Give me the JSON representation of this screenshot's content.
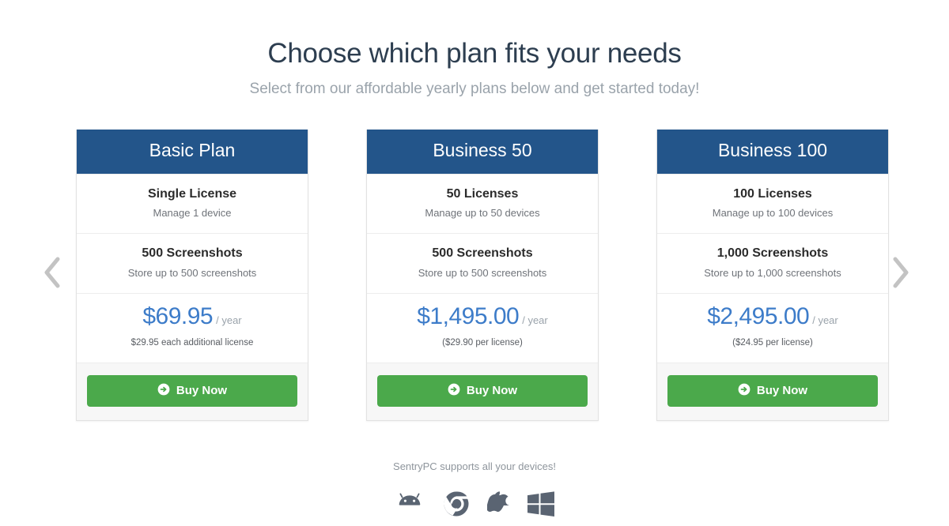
{
  "header": {
    "title": "Choose which plan fits your needs",
    "subtitle": "Select from our affordable yearly plans below and get started today!"
  },
  "carousel": {
    "prev_icon": "chevron-left-icon",
    "next_icon": "chevron-right-icon"
  },
  "colors": {
    "card_header_blue": "#23558a",
    "price_blue": "#3d7cc9",
    "buy_button_green": "#4ba94b",
    "title_dark": "#2d3e50",
    "muted_gray": "#9aa3ab",
    "icon_gray": "#5a6472",
    "footer_bg": "#f7f7f7",
    "card_border": "#e2e2e2"
  },
  "plans": [
    {
      "name": "Basic Plan",
      "license_title": "Single License",
      "license_sub": "Manage 1 device",
      "screenshots_title": "500 Screenshots",
      "screenshots_sub": "Store up to 500 screenshots",
      "price": "$69.95",
      "period": "/ year",
      "price_note": "$29.95 each additional license",
      "buy_label": "Buy Now"
    },
    {
      "name": "Business 50",
      "license_title": "50 Licenses",
      "license_sub": "Manage up to 50 devices",
      "screenshots_title": "500 Screenshots",
      "screenshots_sub": "Store up to 500 screenshots",
      "price": "$1,495.00",
      "period": "/ year",
      "price_note": "($29.90 per license)",
      "buy_label": "Buy Now"
    },
    {
      "name": "Business 100",
      "license_title": "100 Licenses",
      "license_sub": "Manage up to 100 devices",
      "screenshots_title": "1,000 Screenshots",
      "screenshots_sub": "Store up to 1,000 screenshots",
      "price": "$2,495.00",
      "period": "/ year",
      "price_note": "($24.95 per license)",
      "buy_label": "Buy Now"
    }
  ],
  "devices": {
    "text": "SentryPC supports all your devices!",
    "icons": [
      "android-icon",
      "chrome-icon",
      "apple-icon",
      "windows-icon"
    ]
  }
}
